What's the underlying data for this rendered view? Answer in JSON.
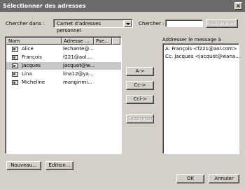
{
  "window": {
    "title": "Sélectionner des adresses",
    "close_label": "×"
  },
  "search_in": {
    "label": "Chercher dans :",
    "value": "Carnet d'adresses personnel"
  },
  "search": {
    "label": "Chercher :",
    "value": "",
    "button": "Supprimer"
  },
  "list": {
    "columns": [
      "Nom",
      "Adresse ...",
      "Pse..."
    ],
    "rows": [
      {
        "name": "Alice",
        "email": "lechante@..."
      },
      {
        "name": "François",
        "email": "f221@aol...."
      },
      {
        "name": "Jacques",
        "email": "jacquot@w..."
      },
      {
        "name": "Lina",
        "email": "lina12@ya..."
      },
      {
        "name": "Micheline",
        "email": "manginmi..."
      }
    ],
    "selected_index": 2
  },
  "actions": {
    "to": "A->",
    "cc": "Cc->",
    "bcc": "Cci->",
    "remove": "Supprimer"
  },
  "recipients": {
    "label": "Addresser le message à",
    "items": [
      "A: François <f221@aol.com>",
      "Cc: Jacques <jacquot@wana..."
    ]
  },
  "bottom": {
    "new": "Nouveau...",
    "edit": "Edition...",
    "ok": "OK",
    "cancel": "Annuler"
  }
}
